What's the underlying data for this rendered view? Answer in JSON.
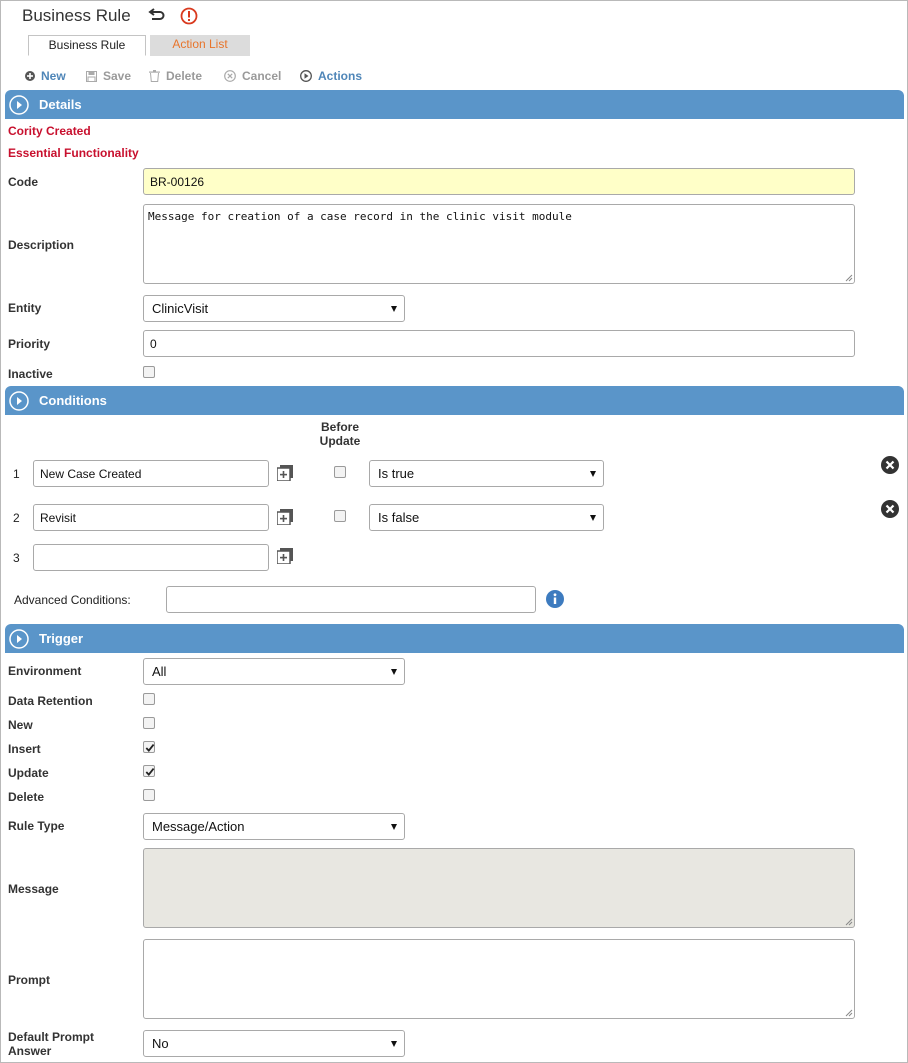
{
  "header": {
    "title": "Business Rule",
    "undo_icon": "undo-icon",
    "info_icon": "info-circle-icon"
  },
  "tabs": [
    {
      "label": "Business Rule",
      "active": true
    },
    {
      "label": "Action List",
      "active": false
    }
  ],
  "toolbar": {
    "new_label": "New",
    "save_label": "Save",
    "delete_label": "Delete",
    "cancel_label": "Cancel",
    "actions_label": "Actions"
  },
  "details": {
    "section_title": "Details",
    "flag_cority": "Cority Created",
    "flag_essential": "Essential Functionality",
    "code_label": "Code",
    "code_value": "BR-00126",
    "description_label": "Description",
    "description_value": "Message for creation of a case record in the clinic visit module",
    "entity_label": "Entity",
    "entity_value": "ClinicVisit",
    "priority_label": "Priority",
    "priority_value": "0",
    "inactive_label": "Inactive",
    "inactive_checked": false
  },
  "conditions": {
    "section_title": "Conditions",
    "before_update_header": "Before Update",
    "rows": [
      {
        "num": "1",
        "value": "New Case Created",
        "before_update": false,
        "operator": "Is true"
      },
      {
        "num": "2",
        "value": "Revisit",
        "before_update": false,
        "operator": "Is false"
      },
      {
        "num": "3",
        "value": "",
        "before_update": null,
        "operator": null
      }
    ],
    "advanced_label": "Advanced Conditions:",
    "advanced_value": ""
  },
  "trigger": {
    "section_title": "Trigger",
    "environment_label": "Environment",
    "environment_value": "All",
    "data_retention_label": "Data Retention",
    "new_label": "New",
    "insert_label": "Insert",
    "update_label": "Update",
    "delete_label": "Delete",
    "checks": {
      "data_retention": false,
      "new": false,
      "insert": true,
      "update": true,
      "delete": false
    },
    "rule_type_label": "Rule Type",
    "rule_type_value": "Message/Action",
    "message_label": "Message",
    "message_value": "",
    "prompt_label": "Prompt",
    "prompt_value": "",
    "default_prompt_label": "Default Prompt Answer",
    "default_prompt_value": "No"
  },
  "colors": {
    "section_header": "#5a95c9",
    "flag_red": "#c8102e",
    "tab_inactive_text": "#e8742a",
    "code_field_bg": "#ffffc8"
  }
}
